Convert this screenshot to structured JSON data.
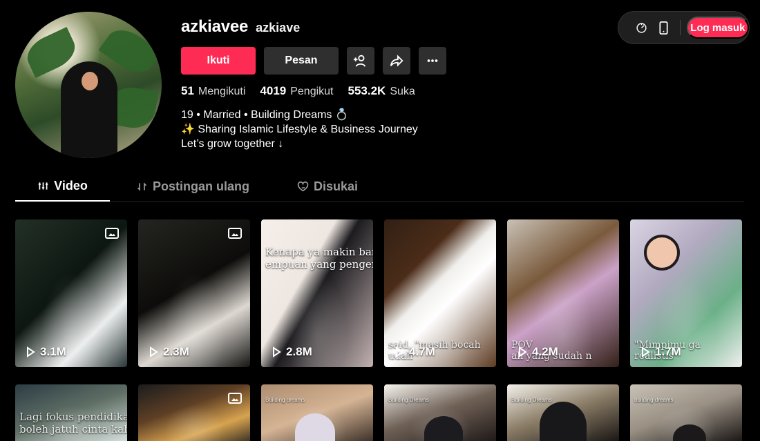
{
  "profile": {
    "display_name": "azkiavee",
    "handle": "azkiave",
    "follow_label": "Ikuti",
    "message_label": "Pesan",
    "stats": [
      {
        "value": "51",
        "label": "Mengikuti"
      },
      {
        "value": "4019",
        "label": "Pengikut"
      },
      {
        "value": "553.2K",
        "label": "Suka"
      }
    ],
    "bio": "19 • Married • Building Dreams 💍\n✨ Sharing Islamic Lifestyle & Business Journey\nLet’s grow together ↓"
  },
  "topbar": {
    "login_label": "Log masuk"
  },
  "tabs": [
    {
      "label": "Video",
      "icon": "video-grid-icon"
    },
    {
      "label": "Postingan ulang",
      "icon": "repost-icon"
    },
    {
      "label": "Disukai",
      "icon": "liked-heart-icon"
    }
  ],
  "videos": [
    {
      "views": "3.1M",
      "caption": "",
      "photo_post": true
    },
    {
      "views": "2.3M",
      "caption": "",
      "photo_post": true
    },
    {
      "views": "2.8M",
      "caption": "Kenapa ya makin banyak\nempuan yang pengen resig",
      "photo_post": false
    },
    {
      "views": "4.7M",
      "caption": "said, \"masih bocah udah",
      "photo_post": false
    },
    {
      "views": "4.2M",
      "caption": "POV\nah yang sudah n",
      "photo_post": false
    },
    {
      "views": "1.7M",
      "caption": "\"Mimpimu ga realistis\"",
      "photo_post": false
    },
    {
      "views": "",
      "caption": "Lagi fokus pendidikan,\nboleh jatuh cinta kah?",
      "photo_post": false
    },
    {
      "views": "",
      "caption": "",
      "photo_post": true
    },
    {
      "views": "",
      "caption": "Building dreams",
      "photo_post": false
    },
    {
      "views": "",
      "caption": "Building Dreams",
      "photo_post": false
    },
    {
      "views": "",
      "caption": "Building Dreams",
      "photo_post": false
    },
    {
      "views": "",
      "caption": "building dreams",
      "photo_post": false
    }
  ],
  "colors": {
    "accent": "#fe2c55",
    "background": "#000000",
    "button": "#2f2f2f",
    "muted_text": "#9a9a9a"
  }
}
